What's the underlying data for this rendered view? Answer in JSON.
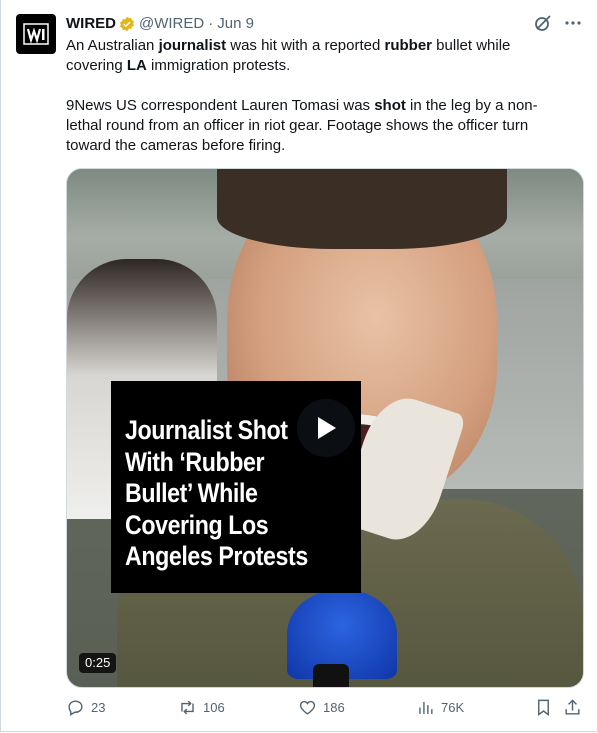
{
  "post": {
    "author_name": "WIRED",
    "handle": "@WIRED",
    "separator": "·",
    "date": "Jun 9",
    "paragraph1": [
      {
        "t": "An Australian ",
        "b": false
      },
      {
        "t": "journalist",
        "b": true
      },
      {
        "t": " was hit with a reported ",
        "b": false
      },
      {
        "t": "rubber",
        "b": true
      },
      {
        "t": " bullet while covering ",
        "b": false
      },
      {
        "t": "LA",
        "b": true
      },
      {
        "t": " immigration protests.",
        "b": false
      }
    ],
    "paragraph2": [
      {
        "t": "9News US correspondent Lauren Tomasi was ",
        "b": false
      },
      {
        "t": "shot",
        "b": true
      },
      {
        "t": " in the leg by a non-lethal round from an officer in riot gear. Footage shows the officer turn toward the cameras before firing.",
        "b": false
      }
    ]
  },
  "media": {
    "overlay_headline": "Journalist Shot\nWith ‘Rubber\nBullet’ While\nCovering Los\nAngeles Protests",
    "duration": "0:25"
  },
  "actions": {
    "replies": "23",
    "reposts": "106",
    "likes": "186",
    "views": "76K"
  },
  "colors": {
    "text": "#0f1419",
    "secondary": "#536471",
    "verified_gold": "#e2b719",
    "border": "#cfd9de"
  },
  "icons": [
    "wired-logo-icon",
    "verified-badge-icon",
    "grok-icon",
    "more-icon",
    "play-icon",
    "reply-icon",
    "repost-icon",
    "like-icon",
    "views-icon",
    "bookmark-icon",
    "share-icon"
  ]
}
